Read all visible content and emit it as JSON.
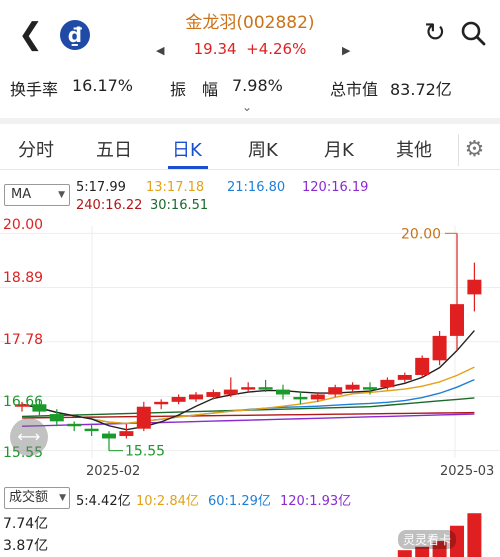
{
  "header": {
    "back_icon": "chevron-left-icon",
    "logo_icon": "bank-logo-icon",
    "title": "金龙羽(002882)",
    "price": "19.34",
    "change": "+4.26%",
    "prev_arrow": "◀",
    "next_arrow": "▶"
  },
  "stats": {
    "turnover_label": "换手率",
    "turnover_value": "16.17%",
    "amplitude_label": "振　幅",
    "amplitude_value": "7.98%",
    "mktcap_label": "总市值",
    "mktcap_value": "83.72亿"
  },
  "tabs": [
    "分时",
    "五日",
    "日K",
    "周K",
    "月K",
    "其他"
  ],
  "active_tab": "日K",
  "ma": {
    "selector": "MA",
    "ma5": "5:17.99",
    "ma13": "13:17.18",
    "ma21": "21:16.80",
    "ma120": "120:16.19",
    "ma240": "240:16.22",
    "ma30": "30:16.51"
  },
  "price_axis": [
    "20.00",
    "18.89",
    "17.78",
    "16.66",
    "15.55"
  ],
  "annotations": {
    "high": "20.00",
    "low": "15.55"
  },
  "dates": [
    "2025-02",
    "2025-03"
  ],
  "volume": {
    "selector": "成交额",
    "v5": "5:4.42亿",
    "v10": "10:2.84亿",
    "v60": "60:1.29亿",
    "v120": "120:1.93亿",
    "axis": [
      "7.74亿",
      "3.87亿"
    ]
  },
  "watermark": "灵灵看卡",
  "colors": {
    "up": "#e02020",
    "down": "#1a9a2a",
    "ma5": "#222222",
    "ma13": "#e3a21a",
    "ma21": "#1e7fd6",
    "ma120": "#8a2bd0",
    "ma240": "#b01818",
    "ma30": "#1a6a2a",
    "accent": "#1a4fd0"
  },
  "chart_data": {
    "type": "candlestick",
    "ylim": [
      15.4,
      20.15
    ],
    "candles": [
      {
        "o": 16.45,
        "h": 16.55,
        "c": 16.5,
        "l": 16.35
      },
      {
        "o": 16.5,
        "h": 16.6,
        "c": 16.35,
        "l": 16.25
      },
      {
        "o": 16.3,
        "h": 16.4,
        "c": 16.15,
        "l": 16.05
      },
      {
        "o": 16.1,
        "h": 16.15,
        "c": 16.05,
        "l": 15.95
      },
      {
        "o": 16.0,
        "h": 16.1,
        "c": 15.95,
        "l": 15.85
      },
      {
        "o": 15.9,
        "h": 15.95,
        "c": 15.8,
        "l": 15.55
      },
      {
        "o": 15.85,
        "h": 16.1,
        "c": 15.95,
        "l": 15.8
      },
      {
        "o": 16.0,
        "h": 16.55,
        "c": 16.45,
        "l": 15.95
      },
      {
        "o": 16.5,
        "h": 16.6,
        "c": 16.55,
        "l": 16.4
      },
      {
        "o": 16.55,
        "h": 16.7,
        "c": 16.65,
        "l": 16.5
      },
      {
        "o": 16.6,
        "h": 16.75,
        "c": 16.7,
        "l": 16.55
      },
      {
        "o": 16.65,
        "h": 16.8,
        "c": 16.75,
        "l": 16.6
      },
      {
        "o": 16.7,
        "h": 17.05,
        "c": 16.8,
        "l": 16.65
      },
      {
        "o": 16.8,
        "h": 16.95,
        "c": 16.85,
        "l": 16.75
      },
      {
        "o": 16.85,
        "h": 17.0,
        "c": 16.8,
        "l": 16.75
      },
      {
        "o": 16.8,
        "h": 16.9,
        "c": 16.7,
        "l": 16.6
      },
      {
        "o": 16.65,
        "h": 16.75,
        "c": 16.6,
        "l": 16.5
      },
      {
        "o": 16.6,
        "h": 16.75,
        "c": 16.7,
        "l": 16.55
      },
      {
        "o": 16.7,
        "h": 16.9,
        "c": 16.85,
        "l": 16.65
      },
      {
        "o": 16.8,
        "h": 16.95,
        "c": 16.9,
        "l": 16.75
      },
      {
        "o": 16.85,
        "h": 16.95,
        "c": 16.8,
        "l": 16.7
      },
      {
        "o": 16.85,
        "h": 17.05,
        "c": 17.0,
        "l": 16.8
      },
      {
        "o": 17.0,
        "h": 17.15,
        "c": 17.1,
        "l": 16.95
      },
      {
        "o": 17.1,
        "h": 17.5,
        "c": 17.45,
        "l": 17.05
      },
      {
        "o": 17.4,
        "h": 18.0,
        "c": 17.9,
        "l": 17.3
      },
      {
        "o": 17.9,
        "h": 20.0,
        "c": 18.55,
        "l": 17.6
      },
      {
        "o": 18.75,
        "h": 19.4,
        "c": 19.05,
        "l": 18.4
      }
    ],
    "volume": [
      1.2,
      1.0,
      0.9,
      0.8,
      0.7,
      0.9,
      0.8,
      1.3,
      1.0,
      1.1,
      1.0,
      1.1,
      1.3,
      1.0,
      0.9,
      0.8,
      0.8,
      0.9,
      1.0,
      1.0,
      0.9,
      1.1,
      1.2,
      1.8,
      2.8,
      5.5,
      7.7
    ]
  }
}
